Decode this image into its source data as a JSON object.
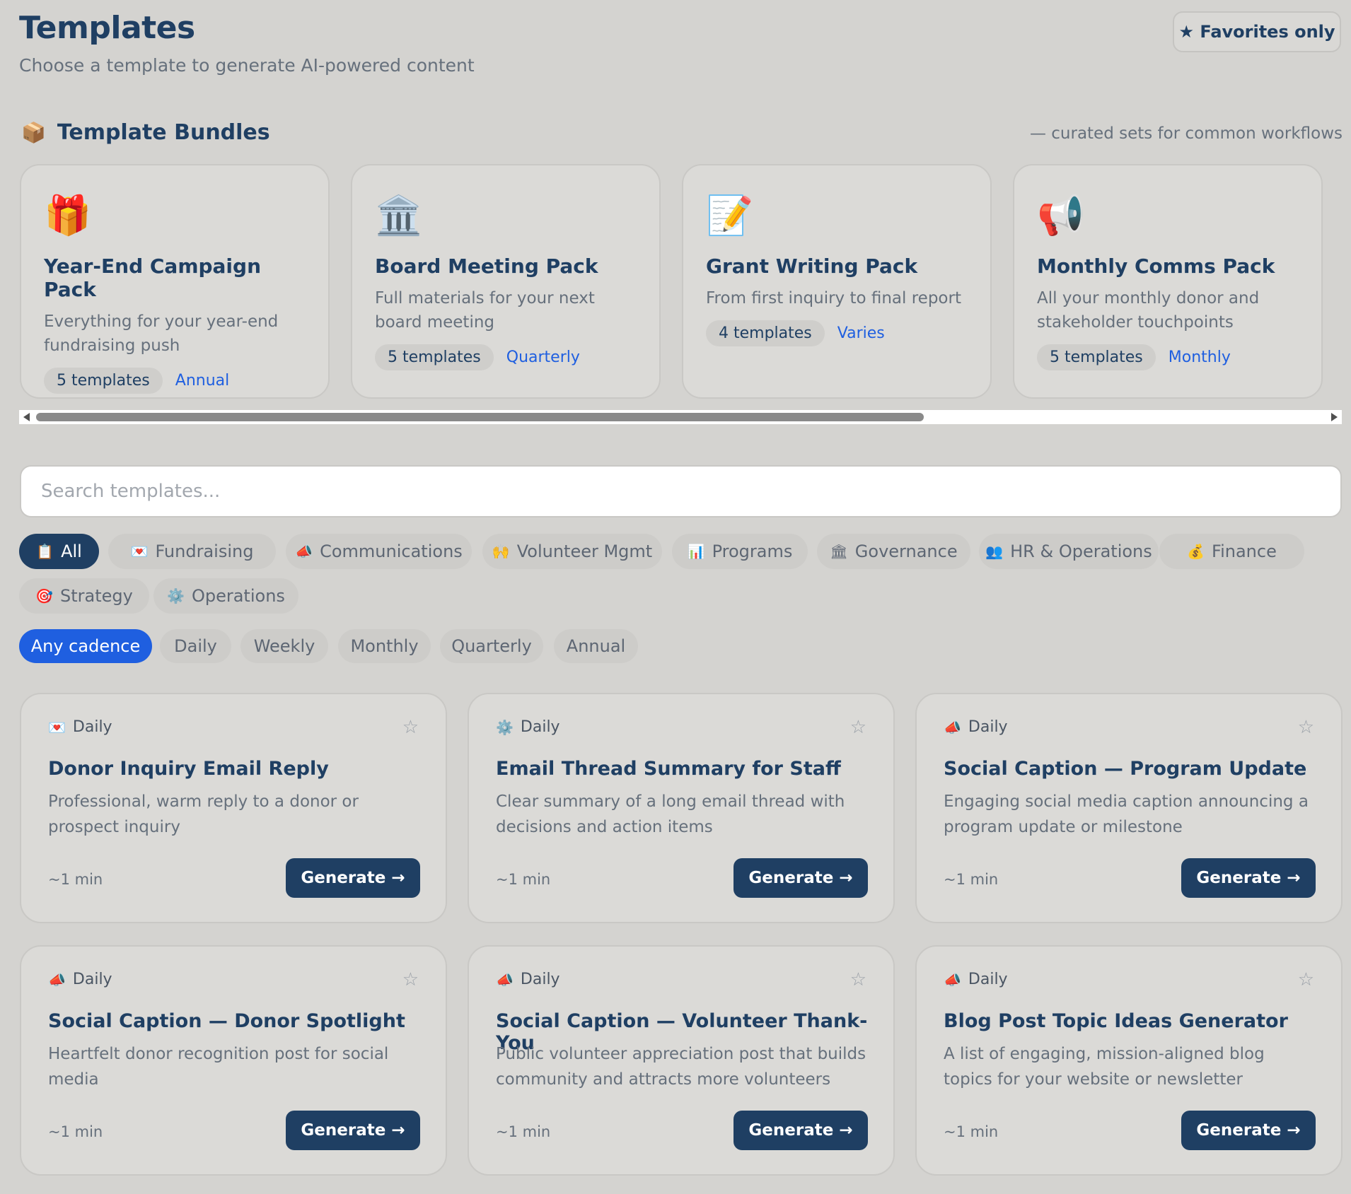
{
  "header": {
    "title": "Templates",
    "subtitle": "Choose a template to generate AI-powered content",
    "favorites_label": "★ Favorites only"
  },
  "bundles": {
    "icon": "📦",
    "title": "Template Bundles",
    "note": "— curated sets for common workflows",
    "items": [
      {
        "icon": "🎁",
        "title": "Year-End Campaign Pack",
        "desc": "Everything for your year-end fundraising push",
        "count": "5 templates",
        "cadence": "Annual"
      },
      {
        "icon": "🏛️",
        "title": "Board Meeting Pack",
        "desc": "Full materials for your next board meeting",
        "count": "5 templates",
        "cadence": "Quarterly"
      },
      {
        "icon": "📝",
        "title": "Grant Writing Pack",
        "desc": "From first inquiry to final report",
        "count": "4 templates",
        "cadence": "Varies"
      },
      {
        "icon": "📢",
        "title": "Monthly Comms Pack",
        "desc": "All your monthly donor and stakeholder touchpoints",
        "count": "5 templates",
        "cadence": "Monthly"
      }
    ]
  },
  "search": {
    "placeholder": "Search templates..."
  },
  "categories": [
    {
      "icon": "📋",
      "label": "All"
    },
    {
      "icon": "💌",
      "label": "Fundraising"
    },
    {
      "icon": "📣",
      "label": "Communications"
    },
    {
      "icon": "🙌",
      "label": "Volunteer Mgmt"
    },
    {
      "icon": "📊",
      "label": "Programs"
    },
    {
      "icon": "🏛",
      "label": "Governance"
    },
    {
      "icon": "👥",
      "label": "HR & Operations"
    },
    {
      "icon": "💰",
      "label": "Finance"
    },
    {
      "icon": "🎯",
      "label": "Strategy"
    },
    {
      "icon": "⚙️",
      "label": "Operations"
    }
  ],
  "cadences": [
    "Any cadence",
    "Daily",
    "Weekly",
    "Monthly",
    "Quarterly",
    "Annual"
  ],
  "templates": [
    {
      "icon": "💌",
      "cadence": "Daily",
      "star": "☆",
      "title": "Donor Inquiry Email Reply",
      "desc": "Professional, warm reply to a donor or prospect inquiry",
      "time": "~1 min",
      "button": "Generate →"
    },
    {
      "icon": "⚙️",
      "cadence": "Daily",
      "star": "☆",
      "title": "Email Thread Summary for Staff",
      "desc": "Clear summary of a long email thread with decisions and action items",
      "time": "~1 min",
      "button": "Generate →"
    },
    {
      "icon": "📣",
      "cadence": "Daily",
      "star": "☆",
      "title": "Social Caption — Program Update",
      "desc": "Engaging social media caption announcing a program update or milestone",
      "time": "~1 min",
      "button": "Generate →"
    },
    {
      "icon": "📣",
      "cadence": "Daily",
      "star": "☆",
      "title": "Social Caption — Donor Spotlight",
      "desc": "Heartfelt donor recognition post for social media",
      "time": "~1 min",
      "button": "Generate →"
    },
    {
      "icon": "📣",
      "cadence": "Daily",
      "star": "☆",
      "title": "Social Caption — Volunteer Thank-You",
      "desc": "Public volunteer appreciation post that builds community and attracts more volunteers",
      "time": "~1 min",
      "button": "Generate →"
    },
    {
      "icon": "📣",
      "cadence": "Daily",
      "star": "☆",
      "title": "Blog Post Topic Ideas Generator",
      "desc": "A list of engaging, mission-aligned blog topics for your website or newsletter",
      "time": "~1 min",
      "button": "Generate →"
    }
  ],
  "colors": {
    "primary": "#1f3f63",
    "accent": "#1f5fe0",
    "background": "#d4d3d0"
  }
}
